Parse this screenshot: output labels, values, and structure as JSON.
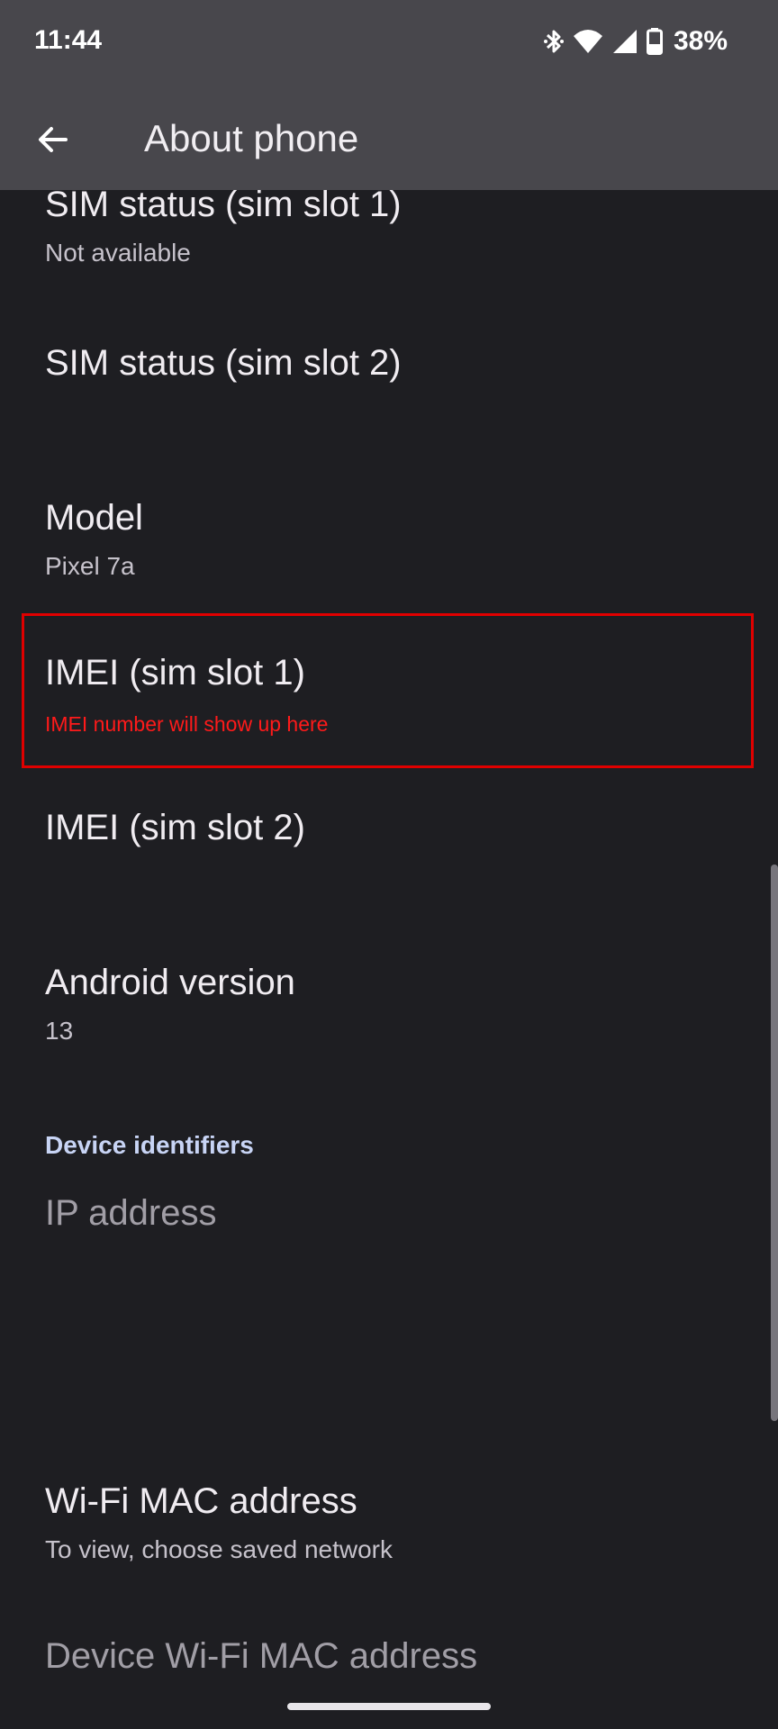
{
  "status_bar": {
    "time": "11:44",
    "battery": "38%",
    "icons": [
      "bluetooth-icon",
      "wifi-icon",
      "cellular-signal-icon",
      "battery-icon"
    ]
  },
  "app_bar": {
    "back_icon": "arrow-back-icon",
    "title": "About phone"
  },
  "items": {
    "sim_status_1": {
      "title": "SIM status (sim slot 1)",
      "summary": "Not available"
    },
    "sim_status_2": {
      "title": "SIM status (sim slot 2)"
    },
    "model": {
      "title": "Model",
      "summary": "Pixel 7a"
    },
    "imei_1": {
      "title": "IMEI (sim slot 1)",
      "annotation": "IMEI number will show up here"
    },
    "imei_2": {
      "title": "IMEI (sim slot 2)"
    },
    "android_version": {
      "title": "Android version",
      "summary": "13"
    }
  },
  "section_device_identifiers": {
    "header": "Device identifiers",
    "ip_address": {
      "title": "IP address"
    },
    "wifi_mac": {
      "title": "Wi-Fi MAC address",
      "summary": "To view, choose saved network"
    },
    "device_wifi_mac": {
      "title": "Device Wi-Fi MAC address"
    }
  },
  "colors": {
    "background": "#1e1e22",
    "app_bar": "#48474c",
    "highlight": "#e00000",
    "section_header": "#c8d4f5"
  }
}
